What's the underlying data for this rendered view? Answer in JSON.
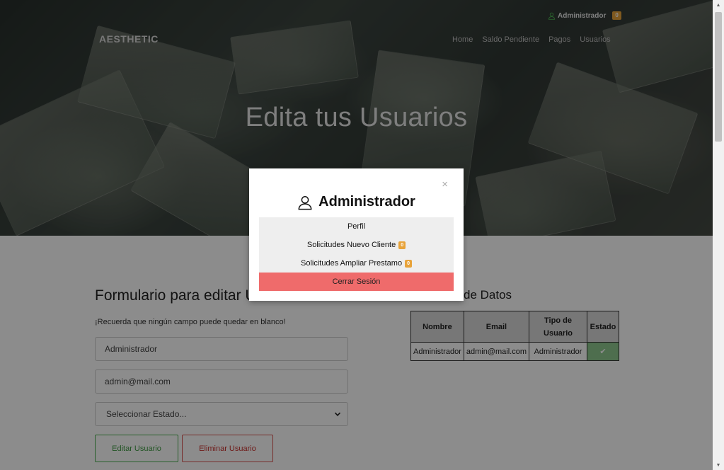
{
  "header": {
    "brand": "AESTHETIC",
    "user_name": "Administrador",
    "user_badge": "0",
    "nav": [
      "Home",
      "Saldo Pendiente",
      "Pagos",
      "Usuarios"
    ]
  },
  "hero": {
    "title": "Edita tus Usuarios"
  },
  "form": {
    "title": "Formulario para editar Usuarios",
    "hint": "¡Recuerda que ningún campo puede quedar en blanco!",
    "name_value": "Administrador",
    "email_value": "admin@mail.com",
    "estado_select": "Seleccionar Estado...",
    "edit_button": "Editar Usuario",
    "delete_button": "Eliminar Usuario"
  },
  "database": {
    "title": "de Datos",
    "columns": [
      "Nombre",
      "Email",
      "Tipo de Usuario",
      "Estado"
    ],
    "rows": [
      {
        "nombre": "Administrador",
        "email": "admin@mail.com",
        "tipo": "Administrador",
        "estado": "✔"
      }
    ]
  },
  "modal": {
    "title": "Administrador",
    "close": "×",
    "items": [
      {
        "label": "Perfil"
      },
      {
        "label": "Solicitudes Nuevo Cliente",
        "badge": "0"
      },
      {
        "label": "Solicitudes Ampliar Prestamo",
        "badge": "0"
      },
      {
        "label": "Cerrar Sesión"
      }
    ]
  },
  "colors": {
    "badge": "#e8a33a",
    "logout": "#ef6b6b",
    "edit_green": "#4caf50",
    "delete_red": "#d9534f",
    "estado_ok": "#8fc98f"
  },
  "icons": {
    "user": "user-icon",
    "close": "close-icon",
    "check": "check-icon",
    "chevron": "chevron-down-icon"
  }
}
